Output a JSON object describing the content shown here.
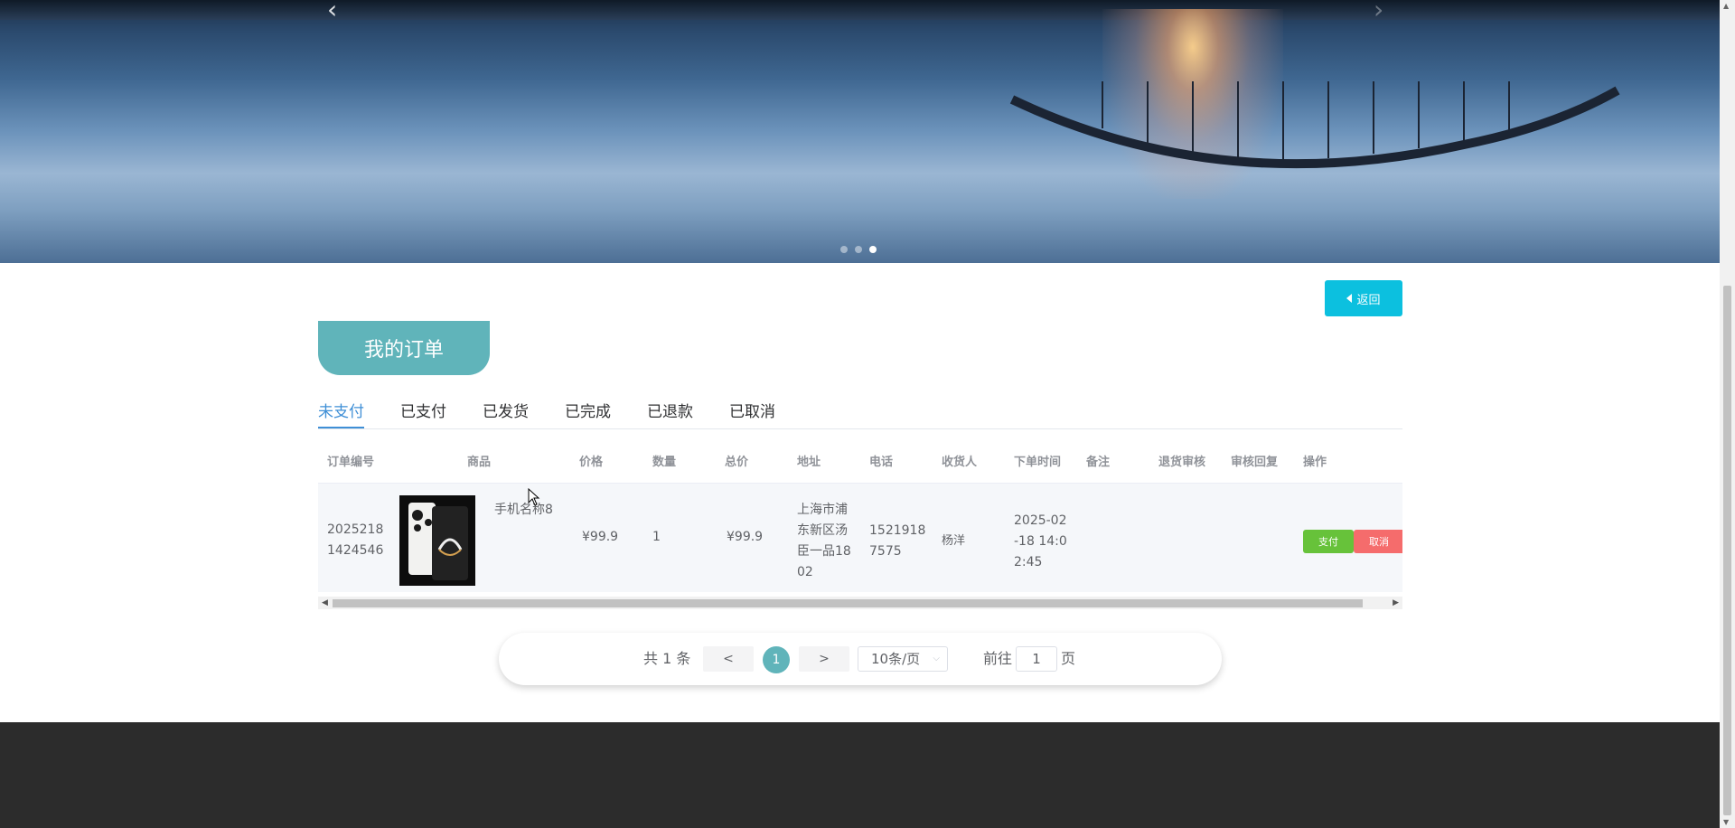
{
  "back_button": {
    "label": "返回"
  },
  "page_title": "我的订单",
  "status_tabs": [
    {
      "label": "未支付",
      "active": true
    },
    {
      "label": "已支付",
      "active": false
    },
    {
      "label": "已发货",
      "active": false
    },
    {
      "label": "已完成",
      "active": false
    },
    {
      "label": "已退款",
      "active": false
    },
    {
      "label": "已取消",
      "active": false
    }
  ],
  "table": {
    "columns": [
      "订单编号",
      "商品",
      "价格",
      "数量",
      "总价",
      "地址",
      "电话",
      "收货人",
      "下单时间",
      "备注",
      "退货审核",
      "审核回复",
      "操作"
    ],
    "rows": [
      {
        "order_no_l1": "2025218",
        "order_no_l2": "1424546",
        "product_name": "手机名称8",
        "price": "¥99.9",
        "quantity": "1",
        "total": "¥99.9",
        "address_l1": "上海市浦",
        "address_l2": "东新区汤",
        "address_l3": "臣一品18",
        "address_l4": "02",
        "phone_l1": "1521918",
        "phone_l2": "7575",
        "receiver": "杨洋",
        "time_l1": "2025-02",
        "time_l2": "-18 14:0",
        "time_l3": "2:45",
        "pay_label": "支付",
        "cancel_label": "取消"
      }
    ]
  },
  "pagination": {
    "total": "共 1 条",
    "prev": "<",
    "current": "1",
    "next": ">",
    "page_size": "10条/页",
    "goto_label": "前往",
    "goto_value": "1",
    "page_unit": "页"
  },
  "icons": {
    "back": "caret-left-icon",
    "prev_slide": "chevron-left-icon",
    "next_slide": "chevron-right-icon",
    "select": "chevron-down-icon"
  },
  "colors": {
    "accent_teal": "#60b4ba",
    "back_button": "#0cc0df",
    "pay": "#67c23a",
    "cancel": "#f56c6c",
    "active_tab": "#3f8fd6",
    "footer": "#2c2c2c"
  }
}
